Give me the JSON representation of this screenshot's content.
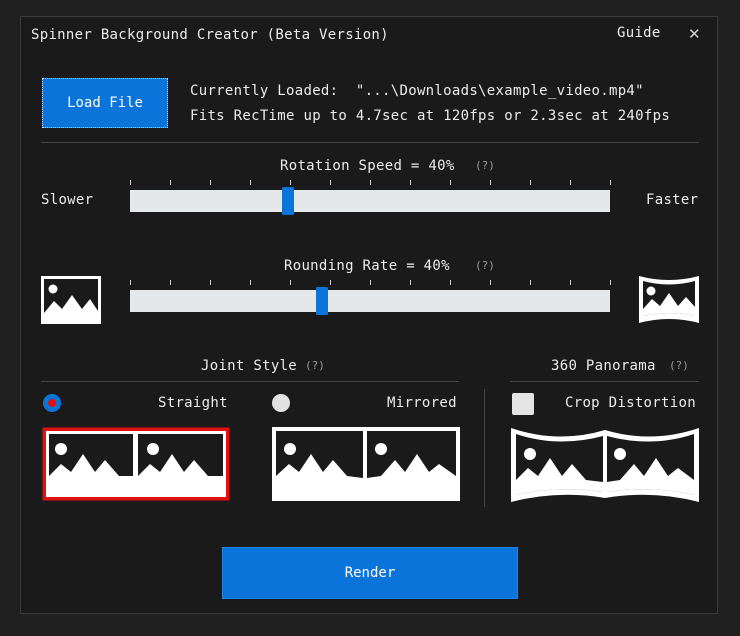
{
  "window": {
    "title": "Spinner Background Creator (Beta Version)",
    "guide_label": "Guide",
    "close_glyph": "✕"
  },
  "load": {
    "button_label": "Load File",
    "status_line1": "Currently Loaded:  \"...\\Downloads\\example_video.mp4\"",
    "status_line2": "Fits RecTime up to 4.7sec at 120fps or 2.3sec at 240fps"
  },
  "rotation": {
    "label": "Rotation Speed = 40%",
    "help": "(?)",
    "left_label": "Slower",
    "right_label": "Faster",
    "value_fraction": 0.33
  },
  "rounding": {
    "label": "Rounding Rate = 40%",
    "help": "(?)",
    "value_fraction": 0.4
  },
  "joint_style": {
    "heading": "Joint Style",
    "help": "(?)",
    "options": [
      {
        "label": "Straight",
        "selected": true
      },
      {
        "label": "Mirrored",
        "selected": false
      }
    ]
  },
  "panorama": {
    "heading": "360 Panorama",
    "help": "(?)",
    "checkbox_label": "Crop Distortion",
    "checked": false
  },
  "render": {
    "button_label": "Render"
  },
  "colors": {
    "accent": "#0a74da",
    "selection": "#e01010"
  }
}
